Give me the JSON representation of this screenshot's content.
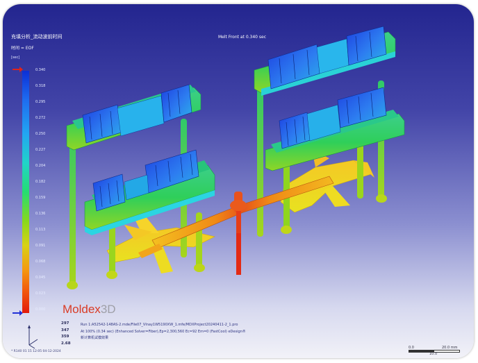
{
  "header": {
    "title": "充填分析_流动波前时间",
    "time_label": "时间 = EOF",
    "unit": "[sec]",
    "melt_front": "Melt Front at      0.340 sec"
  },
  "legend": {
    "values": [
      "0.340",
      "0.318",
      "0.295",
      "0.272",
      "0.250",
      "0.227",
      "0.204",
      "0.182",
      "0.159",
      "0.136",
      "0.113",
      "0.091",
      "0.068",
      "0.045",
      "0.023",
      "0.000"
    ]
  },
  "brand": {
    "name": "Moldex",
    "suffix": "3D"
  },
  "stats": {
    "values": [
      "297",
      "347",
      "359",
      "2.68"
    ]
  },
  "run_info": {
    "line1": "Run 1:A52542-148AS-2.mde/File07_Vlnay1W5190XW_1.mfe/MDXProject20240411-2_1.pro",
    "line2": "At 100% (0.34 sec) (Enhanced Solver=Fiber),Ep=2,300,560 Ec=92 Em=0 (FastCool) eDesign®",
    "line3": "新计算机试模效果"
  },
  "footer": {
    "text": "* R140 01 15 12:05 04-12-2024"
  },
  "scale_bar": {
    "left": "0.0",
    "right": "20.0  mm",
    "mid": "10.0"
  },
  "colors": {
    "background_top": "#23258f",
    "legend_high": "#0b2fd6",
    "legend_low": "#e21a0b",
    "brand_red": "#d93b25"
  }
}
